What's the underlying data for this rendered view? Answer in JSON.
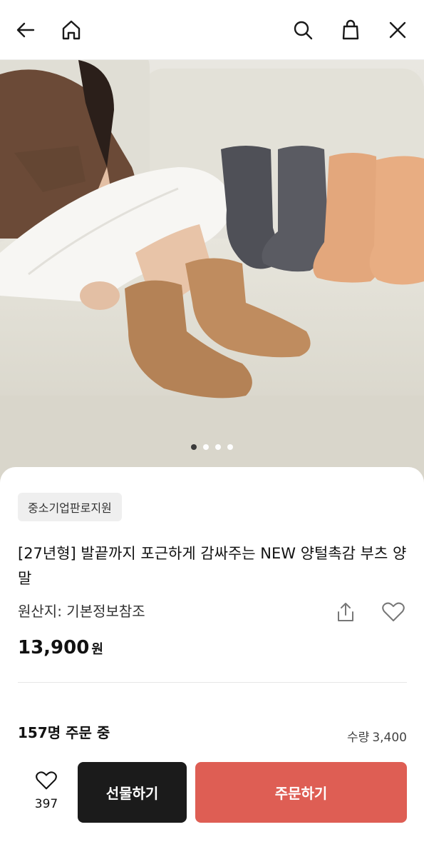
{
  "topbar": {
    "icons": [
      "back-arrow-icon",
      "home-icon",
      "search-icon",
      "shopping-bag-icon",
      "close-icon"
    ]
  },
  "hero": {
    "slide_count": 4,
    "active_index": 0
  },
  "product": {
    "badge": "중소기업판로지원",
    "title": "[27년형] 발끝까지 포근하게 감싸주는 NEW 양털촉감 부츠 양말",
    "origin": "원산지: 기본정보참조",
    "price_value": "13,900",
    "price_unit": "원"
  },
  "stats": {
    "orders": "157명 주문 중",
    "qty_label": "수량",
    "qty_value": "3,400"
  },
  "bottom": {
    "like_count": "397",
    "gift_label": "선물하기",
    "order_label": "주문하기"
  },
  "colors": {
    "order_button": "#de5e54",
    "gift_button": "#1b1b1b"
  }
}
